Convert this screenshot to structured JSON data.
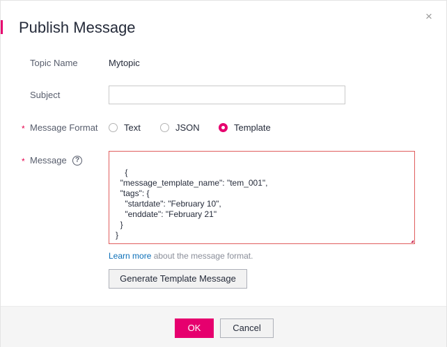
{
  "dialog": {
    "title": "Publish Message",
    "close_symbol": "×"
  },
  "form": {
    "topic_name_label": "Topic Name",
    "topic_name_value": "Mytopic",
    "subject_label": "Subject",
    "subject_value": "",
    "message_format_label": "Message Format",
    "required_marker": "*",
    "formats": [
      {
        "label": "Text",
        "selected": false
      },
      {
        "label": "JSON",
        "selected": false
      },
      {
        "label": "Template",
        "selected": true
      }
    ],
    "message_label": "Message",
    "help_symbol": "?",
    "message_value": "{\n  \"message_template_name\": \"tem_001\",\n  \"tags\": {\n    \"startdate\": \"February 10\",\n    \"enddate\": \"February 21\"\n  }\n}",
    "learn_more_link": "Learn more",
    "learn_more_rest": " about the message format.",
    "generate_button": "Generate Template Message"
  },
  "footer": {
    "ok_label": "OK",
    "cancel_label": "Cancel"
  },
  "colors": {
    "accent": "#e6006e",
    "error_border": "#e05c5c",
    "link": "#0b6fb8"
  }
}
